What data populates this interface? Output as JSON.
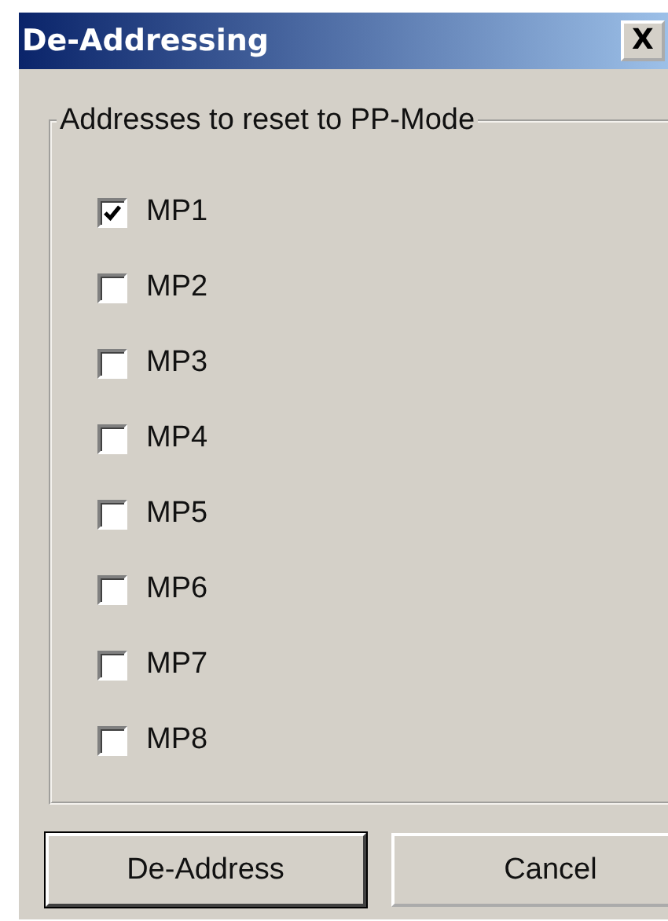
{
  "window": {
    "title": "De-Addressing",
    "close": "X"
  },
  "group": {
    "label": "Addresses to reset to PP-Mode",
    "items": [
      {
        "label": "MP1",
        "checked": true
      },
      {
        "label": "MP2",
        "checked": false
      },
      {
        "label": "MP3",
        "checked": false
      },
      {
        "label": "MP4",
        "checked": false
      },
      {
        "label": "MP5",
        "checked": false
      },
      {
        "label": "MP6",
        "checked": false
      },
      {
        "label": "MP7",
        "checked": false
      },
      {
        "label": "MP8",
        "checked": false
      }
    ]
  },
  "buttons": [
    {
      "label": "De-Address",
      "default": true
    },
    {
      "label": "Cancel",
      "default": false
    }
  ]
}
